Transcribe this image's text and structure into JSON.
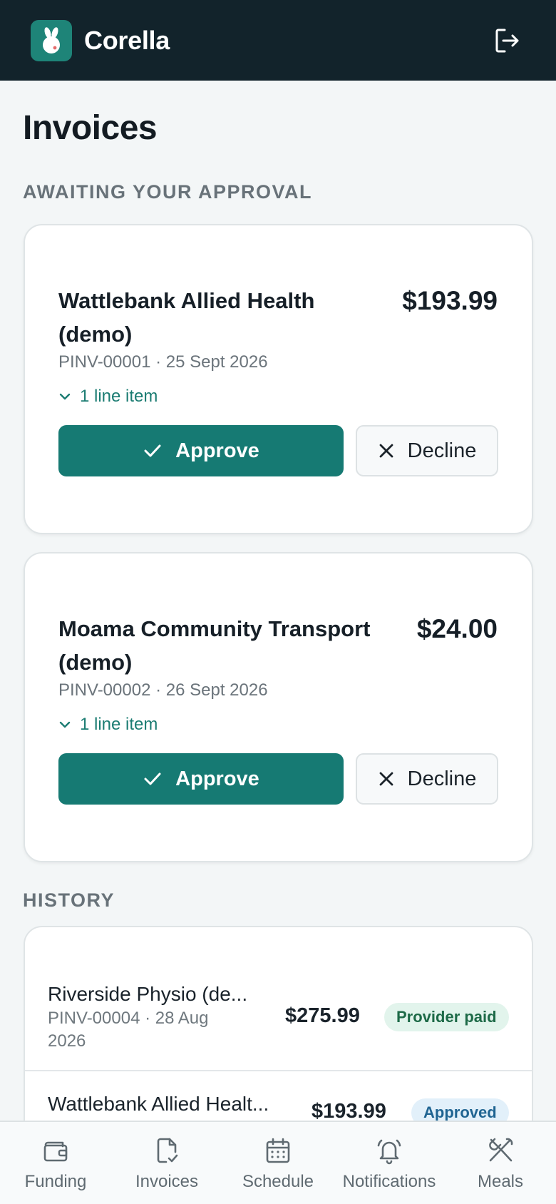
{
  "app": {
    "name": "Corella"
  },
  "page": {
    "title": "Invoices"
  },
  "sections": {
    "awaiting": "AWAITING YOUR APPROVAL",
    "history": "HISTORY"
  },
  "pending_invoices": [
    {
      "provider_line1": "Wattlebank Allied Health",
      "provider_line2": "(demo)",
      "amount": "$193.99",
      "meta": "PINV-00001 · 25 Sept 2026",
      "line_items": "1 line item",
      "approve_label": "Approve",
      "decline_label": "Decline"
    },
    {
      "provider_line1": "Moama Community Transport",
      "provider_line2": "(demo)",
      "amount": "$24.00",
      "meta": "PINV-00002 · 26 Sept 2026",
      "line_items": "1 line item",
      "approve_label": "Approve",
      "decline_label": "Decline"
    }
  ],
  "history": [
    {
      "provider": "Riverside Physio (de...",
      "meta_line1": "PINV-00004 · 28 Aug",
      "meta_line2": "2026",
      "amount": "$275.99",
      "status": "Provider paid"
    },
    {
      "provider": "Wattlebank Allied Healt...",
      "amount": "$193.99",
      "status": "Approved"
    }
  ],
  "nav": [
    {
      "label": "Funding",
      "icon": "wallet-icon"
    },
    {
      "label": "Invoices",
      "icon": "document-icon"
    },
    {
      "label": "Schedule",
      "icon": "calendar-icon"
    },
    {
      "label": "Notifications",
      "icon": "bell-icon"
    },
    {
      "label": "Meals",
      "icon": "utensils-icon"
    }
  ],
  "colors": {
    "header_bg": "#12232b",
    "brand_teal": "#167a73",
    "page_bg": "#f3f6f7",
    "paid_badge_bg": "#e2f4ec",
    "approved_badge_bg": "#e2f0fa"
  }
}
